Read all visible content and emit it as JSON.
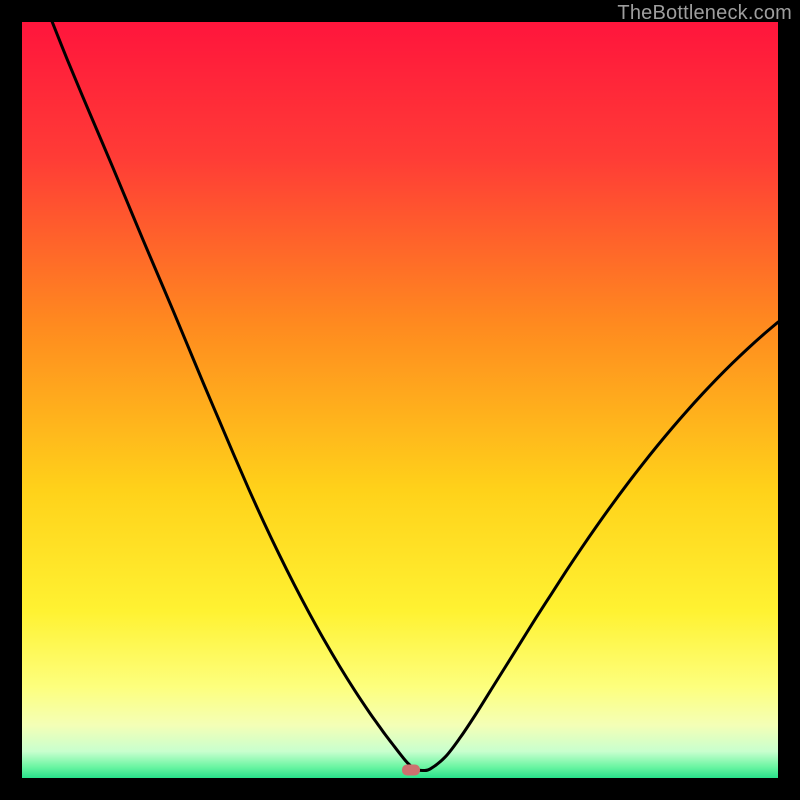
{
  "watermark": "TheBottleneck.com",
  "marker": {
    "x_pct": 51.5,
    "y_pct": 99.0
  },
  "colors": {
    "gradient_stops": [
      {
        "pos": 0.0,
        "color": "#ff153c"
      },
      {
        "pos": 0.18,
        "color": "#ff3c36"
      },
      {
        "pos": 0.4,
        "color": "#ff8a1f"
      },
      {
        "pos": 0.62,
        "color": "#ffd21a"
      },
      {
        "pos": 0.78,
        "color": "#fff232"
      },
      {
        "pos": 0.88,
        "color": "#fdff7e"
      },
      {
        "pos": 0.93,
        "color": "#f4ffb6"
      },
      {
        "pos": 0.965,
        "color": "#c8ffce"
      },
      {
        "pos": 0.985,
        "color": "#6cf5a3"
      },
      {
        "pos": 1.0,
        "color": "#28e08a"
      }
    ],
    "curve": "#000000",
    "marker": "#cd706f"
  },
  "chart_data": {
    "type": "line",
    "title": "",
    "xlabel": "",
    "ylabel": "",
    "xlim": [
      0,
      100
    ],
    "ylim": [
      0,
      100
    ],
    "series": [
      {
        "name": "bottleneck-curve",
        "x": [
          4,
          6,
          8,
          10,
          12,
          14,
          16,
          18,
          20,
          22,
          24,
          26,
          28,
          30,
          32,
          34,
          36,
          38,
          40,
          42,
          44,
          46,
          47,
          48,
          49,
          50,
          51,
          52,
          53,
          54,
          56,
          58,
          60,
          62,
          64,
          66,
          68,
          70,
          72,
          74,
          76,
          78,
          80,
          82,
          84,
          86,
          88,
          90,
          92,
          94,
          96,
          98,
          100
        ],
        "y": [
          100,
          95,
          90.2,
          85.5,
          80.8,
          76,
          71.2,
          66.5,
          61.8,
          57,
          52.2,
          47.5,
          42.8,
          38.2,
          33.8,
          29.6,
          25.6,
          21.8,
          18.2,
          14.8,
          11.6,
          8.6,
          7.2,
          5.8,
          4.5,
          3.2,
          2.0,
          1.2,
          1.0,
          1.2,
          2.8,
          5.4,
          8.4,
          11.6,
          14.8,
          18,
          21.2,
          24.3,
          27.4,
          30.4,
          33.3,
          36.1,
          38.8,
          41.4,
          43.9,
          46.3,
          48.6,
          50.8,
          52.9,
          54.9,
          56.8,
          58.6,
          60.3
        ]
      }
    ],
    "background_gradient": "red-yellow-green vertical",
    "optimal_marker": {
      "x": 51.5,
      "y": 1.0
    }
  }
}
